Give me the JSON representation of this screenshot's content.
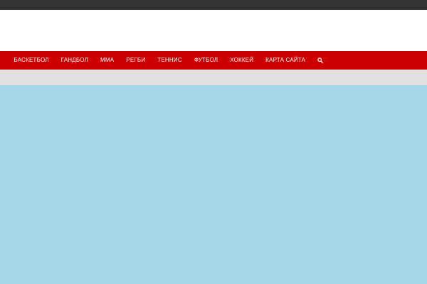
{
  "nav": {
    "items": [
      {
        "label": "БАСКЕТБОЛ"
      },
      {
        "label": "ГАНДБОЛ"
      },
      {
        "label": "ММА"
      },
      {
        "label": "РЕГБИ"
      },
      {
        "label": "ТЕННИС"
      },
      {
        "label": "ФУТБОЛ"
      },
      {
        "label": "ХОККЕЙ"
      },
      {
        "label": "КАРТА САЙТА"
      }
    ],
    "search_icon": "search-icon"
  },
  "colors": {
    "topbar": "#333333",
    "header": "#ffffff",
    "nav": "#cc0000",
    "subbar": "#e0e0e0",
    "main": "#a5d8e6"
  }
}
